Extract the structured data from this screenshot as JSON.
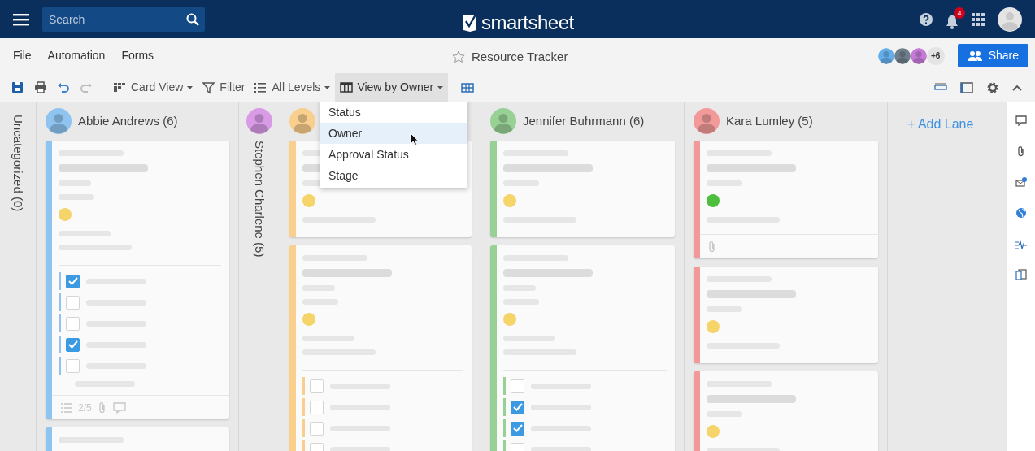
{
  "top_bar": {
    "search": {
      "placeholder": "Search"
    },
    "logo": "smartsheet",
    "notification_count": "4"
  },
  "menu": [
    "File",
    "Automation",
    "Forms"
  ],
  "sheet_title": {
    "text": "Resource Tracker",
    "favorite": false
  },
  "collaborators": [
    {
      "color": "#64aeea"
    },
    {
      "color": "#6e7e8a"
    },
    {
      "color": "#c57ad8"
    }
  ],
  "more_collaborators": "+6",
  "share_button": "Share",
  "toolbar": [
    {
      "kind": "save"
    },
    {
      "kind": "print"
    },
    {
      "kind": "undo"
    },
    {
      "kind": "redo",
      "disabled": true
    },
    {
      "kind": "card-view",
      "label": "Card View",
      "dropdown": true,
      "expanded": false
    },
    {
      "kind": "filter",
      "label": "Filter",
      "expanded": false
    },
    {
      "kind": "levels",
      "label": "All Levels",
      "dropdown": true,
      "expanded": false
    },
    {
      "kind": "view-by",
      "label": "View by Owner",
      "dropdown": true,
      "expanded": true
    },
    {
      "kind": "lane-settings"
    }
  ],
  "view_menu": [
    {
      "label": "Status",
      "selected": false
    },
    {
      "label": "Owner",
      "selected": true
    },
    {
      "label": "Approval Status",
      "selected": false
    },
    {
      "label": "Stage",
      "selected": false
    }
  ],
  "lanes": [
    {
      "kind": "collapsed",
      "title": "Uncategorized (0)"
    },
    {
      "kind": "lane",
      "title": "Abbie Andrews (6)",
      "color": "#8fc4f1",
      "cards": [
        {
          "kind": "task",
          "color": "#f5d469",
          "checklist": [
            {
              "checked": true
            },
            {
              "checked": false
            },
            {
              "checked": false
            },
            {
              "checked": true
            },
            {
              "checked": false
            }
          ],
          "footer": {
            "progress": "2/5",
            "attachment": true,
            "comment": true
          }
        },
        {
          "kind": "task"
        }
      ]
    },
    {
      "kind": "collapsed",
      "title": "Stephen Charlene (5)",
      "color": "#d99be6"
    },
    {
      "kind": "lane",
      "color": "#f9cf8e",
      "cards": [
        {
          "kind": "task",
          "color": "#f5d469"
        },
        {
          "kind": "task",
          "color": "#f5d469",
          "checklist": [
            {
              "checked": false
            },
            {
              "checked": false
            },
            {
              "checked": false
            },
            {
              "checked": false
            }
          ]
        }
      ]
    },
    {
      "kind": "lane",
      "title": "Jennifer Buhrmann (6)",
      "color": "#98d196",
      "cards": [
        {
          "kind": "task",
          "color": "#f5d469"
        },
        {
          "kind": "task",
          "color": "#f5d469",
          "checklist": [
            {
              "checked": false
            },
            {
              "checked": true
            },
            {
              "checked": true
            },
            {
              "checked": false
            }
          ]
        }
      ]
    },
    {
      "kind": "lane",
      "title": "Kara Lumley (5)",
      "color": "#f29a9a",
      "cards": [
        {
          "kind": "task",
          "color": "#4cbf3c",
          "footer": {
            "attachment": true
          }
        },
        {
          "kind": "task",
          "color": "#f5d469"
        },
        {
          "kind": "task",
          "color": "#f5d469"
        }
      ]
    }
  ],
  "add_lane": "+ Add Lane"
}
